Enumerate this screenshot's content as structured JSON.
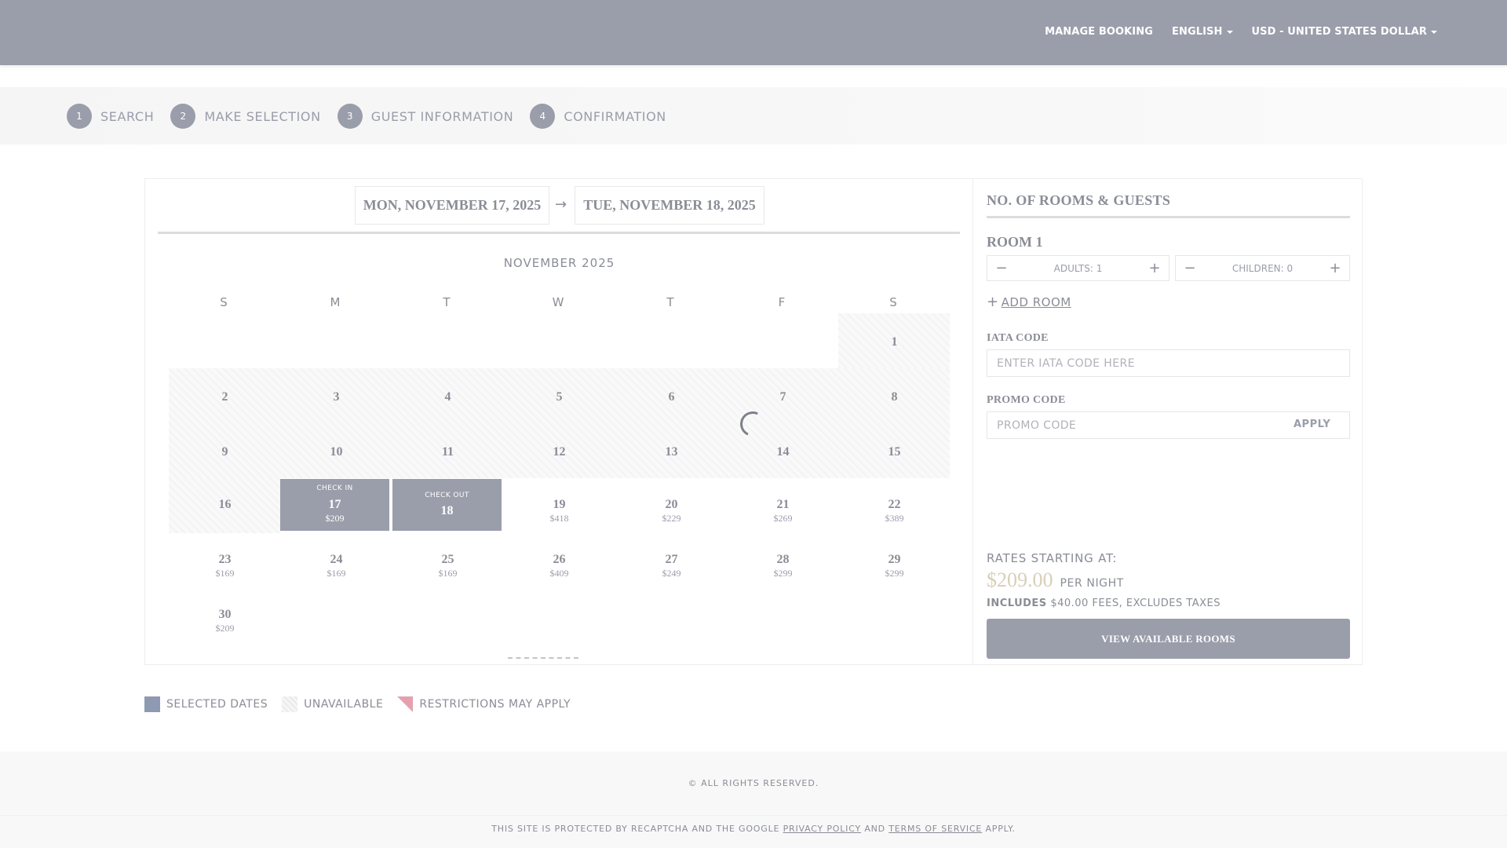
{
  "header": {
    "nav": {
      "manage_booking": "MANAGE BOOKING",
      "language": "ENGLISH",
      "currency": "USD - UNITED STATES DOLLAR"
    }
  },
  "steps": [
    {
      "num": "1",
      "label": "SEARCH"
    },
    {
      "num": "2",
      "label": "MAKE SELECTION"
    },
    {
      "num": "3",
      "label": "GUEST INFORMATION"
    },
    {
      "num": "4",
      "label": "CONFIRMATION"
    }
  ],
  "dates": {
    "check_in": "MON, NOVEMBER 17, 2025",
    "arrow": "→",
    "check_out": "TUE, NOVEMBER 18, 2025"
  },
  "calendar": {
    "month_title": "NOVEMBER 2025",
    "weekdays": [
      "S",
      "M",
      "T",
      "W",
      "T",
      "F",
      "S"
    ],
    "days": {
      "d1": {
        "day": "1",
        "price": ""
      },
      "d2": {
        "day": "2",
        "price": ""
      },
      "d3": {
        "day": "3",
        "price": ""
      },
      "d4": {
        "day": "4",
        "price": ""
      },
      "d5": {
        "day": "5",
        "price": ""
      },
      "d6": {
        "day": "6",
        "price": ""
      },
      "d7": {
        "day": "7",
        "price": ""
      },
      "d8": {
        "day": "8",
        "price": ""
      },
      "d9": {
        "day": "9",
        "price": ""
      },
      "d10": {
        "day": "10",
        "price": ""
      },
      "d11": {
        "day": "11",
        "price": ""
      },
      "d12": {
        "day": "12",
        "price": ""
      },
      "d13": {
        "day": "13",
        "price": ""
      },
      "d14": {
        "day": "14",
        "price": ""
      },
      "d15": {
        "day": "15",
        "price": ""
      },
      "d16": {
        "day": "16",
        "price": ""
      },
      "d17": {
        "day": "17",
        "price": "$209",
        "tag": "CHECK IN"
      },
      "d18": {
        "day": "18",
        "price": "",
        "tag": "CHECK OUT"
      },
      "d19": {
        "day": "19",
        "price": "$418"
      },
      "d20": {
        "day": "20",
        "price": "$229"
      },
      "d21": {
        "day": "21",
        "price": "$269"
      },
      "d22": {
        "day": "22",
        "price": "$389"
      },
      "d23": {
        "day": "23",
        "price": "$169"
      },
      "d24": {
        "day": "24",
        "price": "$169"
      },
      "d25": {
        "day": "25",
        "price": "$169"
      },
      "d26": {
        "day": "26",
        "price": "$409"
      },
      "d27": {
        "day": "27",
        "price": "$249"
      },
      "d28": {
        "day": "28",
        "price": "$299"
      },
      "d29": {
        "day": "29",
        "price": "$299"
      },
      "d30": {
        "day": "30",
        "price": "$209"
      }
    }
  },
  "panel": {
    "heading": "NO. OF ROOMS & GUESTS",
    "room_title": "ROOM 1",
    "adults": "ADULTS: 1",
    "children": "CHILDREN: 0",
    "minus": "−",
    "plus": "+",
    "add_room": "ADD ROOM",
    "iata_label": "IATA CODE",
    "iata_placeholder": "ENTER IATA CODE HERE",
    "promo_label": "PROMO CODE",
    "promo_placeholder": "PROMO CODE",
    "apply": "APPLY",
    "rates_label": "RATES STARTING AT:",
    "rate_amount": "$209.00",
    "per_night": "PER NIGHT",
    "includes": "INCLUDES",
    "fees_text": "$40.00 FEES, EXCLUDES TAXES",
    "view_button": "VIEW AVAILABLE ROOMS"
  },
  "legend": {
    "selected": "SELECTED DATES",
    "unavailable": "UNAVAILABLE",
    "restrictions": "RESTRICTIONS MAY APPLY"
  },
  "footer": {
    "copyright": "© ALL RIGHTS RESERVED.",
    "recaptcha_prefix": "THIS SITE IS PROTECTED BY RECAPTCHA AND THE GOOGLE",
    "privacy": "PRIVACY POLICY",
    "and": "AND",
    "terms": "TERMS OF SERVICE",
    "suffix": "APPLY."
  },
  "colors": {
    "header_bg": "#9a9daa",
    "selected": "#9a9daa",
    "price_accent": "#d8cfb8",
    "restriction": "#e4a0ae"
  }
}
